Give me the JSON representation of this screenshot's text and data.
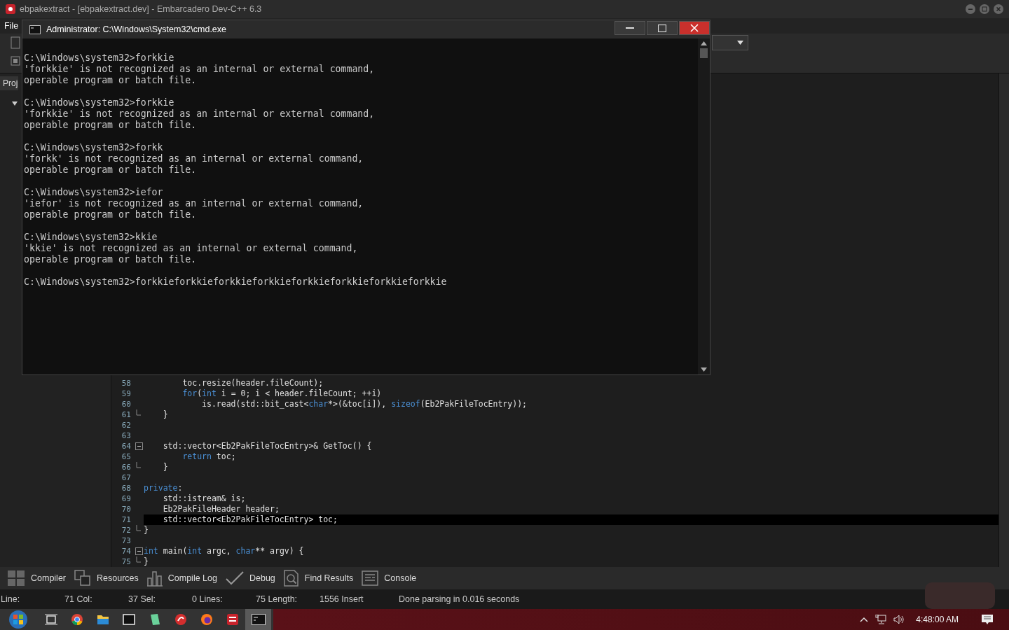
{
  "window": {
    "title": "ebpakextract - [ebpakextract.dev] - Embarcadero Dev-C++ 6.3"
  },
  "menu": [
    {
      "label": "File"
    }
  ],
  "project_panel": {
    "tab": "Proj"
  },
  "editor": {
    "lines": [
      {
        "number": "58",
        "fold_open": false,
        "fold_end": false,
        "highlighted": false,
        "segments": [
          {
            "kind": "plain",
            "text": "        toc.resize(header.fileCount);"
          }
        ]
      },
      {
        "number": "59",
        "fold_open": false,
        "fold_end": false,
        "highlighted": false,
        "segments": [
          {
            "kind": "kw",
            "text": "        for"
          },
          {
            "kind": "plain",
            "text": "("
          },
          {
            "kind": "kw",
            "text": "int"
          },
          {
            "kind": "plain",
            "text": " i = 0; i < header.fileCount; ++i)"
          }
        ]
      },
      {
        "number": "60",
        "fold_open": false,
        "fold_end": false,
        "highlighted": false,
        "segments": [
          {
            "kind": "plain",
            "text": "            is.read(std::bit_cast<"
          },
          {
            "kind": "kw",
            "text": "char"
          },
          {
            "kind": "plain",
            "text": "*>(&toc[i]), "
          },
          {
            "kind": "kw",
            "text": "sizeof"
          },
          {
            "kind": "plain",
            "text": "(Eb2PakFileTocEntry));"
          }
        ]
      },
      {
        "number": "61",
        "fold_open": false,
        "fold_end": true,
        "highlighted": false,
        "segments": [
          {
            "kind": "plain",
            "text": "    }"
          }
        ]
      },
      {
        "number": "62",
        "fold_open": false,
        "fold_end": false,
        "highlighted": false
      },
      {
        "number": "63",
        "fold_open": false,
        "fold_end": false,
        "highlighted": false
      },
      {
        "number": "64",
        "fold_open": true,
        "fold_end": false,
        "highlighted": false,
        "segments": [
          {
            "kind": "plain",
            "text": "    std::vector<Eb2PakFileTocEntry>& GetToc() {"
          }
        ]
      },
      {
        "number": "65",
        "fold_open": false,
        "fold_end": false,
        "highlighted": false,
        "segments": [
          {
            "kind": "kw",
            "text": "        return"
          },
          {
            "kind": "plain",
            "text": " toc;"
          }
        ]
      },
      {
        "number": "66",
        "fold_open": false,
        "fold_end": true,
        "highlighted": false,
        "segments": [
          {
            "kind": "plain",
            "text": "    }"
          }
        ]
      },
      {
        "number": "67",
        "fold_open": false,
        "fold_end": false,
        "highlighted": false
      },
      {
        "number": "68",
        "fold_open": false,
        "fold_end": false,
        "highlighted": false,
        "segments": [
          {
            "kind": "kw",
            "text": "private"
          },
          {
            "kind": "plain",
            "text": ":"
          }
        ]
      },
      {
        "number": "69",
        "fold_open": false,
        "fold_end": false,
        "highlighted": false,
        "segments": [
          {
            "kind": "plain",
            "text": "    std::istream& is;"
          }
        ]
      },
      {
        "number": "70",
        "fold_open": false,
        "fold_end": false,
        "highlighted": false,
        "segments": [
          {
            "kind": "plain",
            "text": "    Eb2PakFileHeader header;"
          }
        ]
      },
      {
        "number": "71",
        "fold_open": false,
        "fold_end": false,
        "highlighted": true,
        "segments": [
          {
            "kind": "plain",
            "text": "    std::vector<Eb2PakFileTocEntry> toc;"
          }
        ]
      },
      {
        "number": "72",
        "fold_open": false,
        "fold_end": true,
        "highlighted": false,
        "segments": [
          {
            "kind": "plain",
            "text": "}"
          }
        ]
      },
      {
        "number": "73",
        "fold_open": false,
        "fold_end": false,
        "highlighted": false
      },
      {
        "number": "74",
        "fold_open": true,
        "fold_end": false,
        "highlighted": false,
        "segments": [
          {
            "kind": "kw",
            "text": "int"
          },
          {
            "kind": "plain",
            "text": " main("
          },
          {
            "kind": "kw",
            "text": "int"
          },
          {
            "kind": "plain",
            "text": " argc, "
          },
          {
            "kind": "kw",
            "text": "char"
          },
          {
            "kind": "plain",
            "text": "** argv) {"
          }
        ]
      },
      {
        "number": "75",
        "fold_open": false,
        "fold_end": true,
        "highlighted": false,
        "segments": [
          {
            "kind": "plain",
            "text": "}"
          }
        ]
      }
    ]
  },
  "bottom_tabs": [
    {
      "label": "Compiler",
      "kind": "grid"
    },
    {
      "label": "Resources",
      "kind": "copies"
    },
    {
      "label": "Compile Log",
      "kind": "bars"
    },
    {
      "label": "Debug",
      "kind": "check"
    },
    {
      "label": "Find Results",
      "kind": "find"
    },
    {
      "label": "Console",
      "kind": "console"
    }
  ],
  "status_bar": [
    "Line:",
    "71 Col:",
    "37 Sel:",
    "0 Lines:",
    "75 Length:",
    "1556 Insert",
    "Done parsing in 0.016 seconds"
  ],
  "cmd_window": {
    "title": "Administrator: C:\\Windows\\System32\\cmd.exe",
    "entries": [
      {
        "prompt": "C:\\Windows\\system32>forkkie",
        "output": [
          "'forkkie' is not recognized as an internal or external command,",
          "operable program or batch file."
        ]
      },
      {
        "prompt": "C:\\Windows\\system32>forkkie",
        "output": [
          "'forkkie' is not recognized as an internal or external command,",
          "operable program or batch file."
        ]
      },
      {
        "prompt": "C:\\Windows\\system32>forkk",
        "output": [
          "'forkk' is not recognized as an internal or external command,",
          "operable program or batch file."
        ]
      },
      {
        "prompt": "C:\\Windows\\system32>iefor",
        "output": [
          "'iefor' is not recognized as an internal or external command,",
          "operable program or batch file."
        ]
      },
      {
        "prompt": "C:\\Windows\\system32>kkie",
        "output": [
          "'kkie' is not recognized as an internal or external command,",
          "operable program or batch file."
        ]
      },
      {
        "prompt": "C:\\Windows\\system32>forkkieforkkieforkkieforkkieforkkieforkkieforkkieforkkie"
      }
    ]
  },
  "taskbar": {
    "apps": [
      {
        "kind": "taskview",
        "selected": false
      },
      {
        "kind": "chrome",
        "selected": false
      },
      {
        "kind": "folder",
        "selected": false
      },
      {
        "kind": "archive",
        "selected": false
      },
      {
        "kind": "book",
        "selected": false
      },
      {
        "kind": "red",
        "selected": false
      },
      {
        "kind": "firefox",
        "selected": false
      },
      {
        "kind": "devcpp",
        "selected": false
      },
      {
        "kind": "cmd",
        "selected": true
      }
    ],
    "clock": "4:48:00 AM"
  }
}
